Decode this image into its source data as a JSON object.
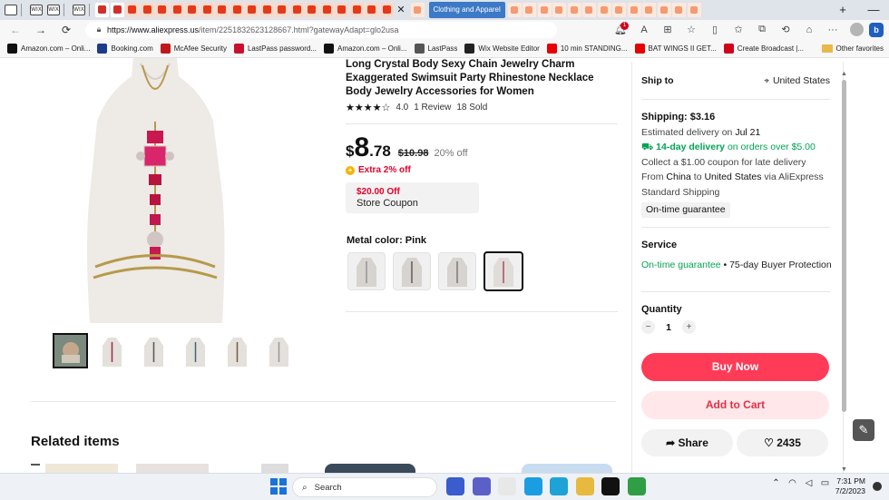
{
  "browser": {
    "tab_icon_labels": [
      "WIX",
      "WIX",
      "WIX"
    ],
    "active_tab_title": "Clothing and Apparel",
    "url_host": "https://www.aliexpress.us",
    "url_path": "/item/2251832623128667.html?gatewayAdapt=glo2usa",
    "new_tab": "+",
    "minimize": "—",
    "close_tab": "✕",
    "notification_count": "1",
    "bing_label": "b"
  },
  "bookmarks": {
    "items": [
      {
        "label": "Amazon.com – Onli...",
        "icon": "amazon-icon",
        "color": "#111111"
      },
      {
        "label": "Booking.com",
        "icon": "booking-icon",
        "color": "#1c3b8a"
      },
      {
        "label": "McAfee Security",
        "icon": "mcafee-icon",
        "color": "#c01818"
      },
      {
        "label": "LastPass password...",
        "icon": "lastpass-icon",
        "color": "#c8102e"
      },
      {
        "label": "Amazon.com – Onli...",
        "icon": "amazon-icon",
        "color": "#111111"
      },
      {
        "label": "LastPass",
        "icon": "doc-icon",
        "color": "#555555"
      },
      {
        "label": "Wix Website Editor",
        "icon": "wix-icon",
        "color": "#222222"
      },
      {
        "label": "10 min STANDING...",
        "icon": "youtube-icon",
        "color": "#e60000"
      },
      {
        "label": "BAT WINGS II GET...",
        "icon": "youtube-icon",
        "color": "#e60000"
      },
      {
        "label": "Create Broadcast |...",
        "icon": "star-icon",
        "color": "#d0021b"
      }
    ],
    "other_favorites": "Other favorites"
  },
  "product": {
    "title": "Long Crystal Body Sexy Chain Jewelry Charm Exaggerated Swimsuit Party Rhinestone Necklace Body Jewelry Accessories for Women",
    "rating": "4.0",
    "reviews": "1 Review",
    "sold": "18 Sold",
    "stars": "★★★★☆",
    "currency": "$",
    "price_int": "8",
    "price_dec": ".78",
    "original_price": "$10.98",
    "discount": "20% off",
    "extra_off": "Extra 2% off",
    "coupon_amount": "$20.00 Off",
    "coupon_label": "Store Coupon",
    "metal_label": "Metal color:",
    "metal_value": "Pink",
    "swatch_count": 4,
    "selected_swatch": 4
  },
  "related": {
    "title": "Related items"
  },
  "sidebar": {
    "ship_to_label": "Ship to",
    "ship_country": "United States",
    "shipping_cost": "Shipping: $3.16",
    "estimated_prefix": "Estimated delivery on ",
    "estimated_date": "Jul 21",
    "fast_delivery": "14-day delivery",
    "fast_delivery_suffix": " on orders over $5.00",
    "late_coupon": "Collect a $1.00 coupon for late delivery",
    "from_prefix": "From ",
    "from_country": "China",
    "to_word": " to ",
    "to_country": "United States",
    "via_text": " via AliExpress Standard Shipping",
    "ontime_chip": "On-time guarantee",
    "service_title": "Service",
    "service_green": "On-time guarantee",
    "service_rest": " • 75-day Buyer Protection",
    "quantity_title": "Quantity",
    "quantity_minus": "−",
    "quantity_value": "1",
    "quantity_plus": "+",
    "buy_now": "Buy Now",
    "add_to_cart": "Add to Cart",
    "share": "Share",
    "wishlist_count": "2435"
  },
  "taskbar": {
    "search_placeholder": "Search",
    "time": "7:31 PM",
    "date": "7/2/2023",
    "apps": [
      {
        "icon": "edge-shopping-icon",
        "color": "#3a5ccc"
      },
      {
        "icon": "teams-icon",
        "color": "#5b5fc7"
      },
      {
        "icon": "store-icon",
        "color": "#e8e8e8"
      },
      {
        "icon": "edge-icon",
        "color": "#1b9de2"
      },
      {
        "icon": "my-app-icon",
        "color": "#1fa3d6"
      },
      {
        "icon": "folder-icon",
        "color": "#e7b93f"
      },
      {
        "icon": "tiktok-icon",
        "color": "#111111"
      },
      {
        "icon": "chrome-icon",
        "color": "#2f9e44"
      }
    ]
  }
}
